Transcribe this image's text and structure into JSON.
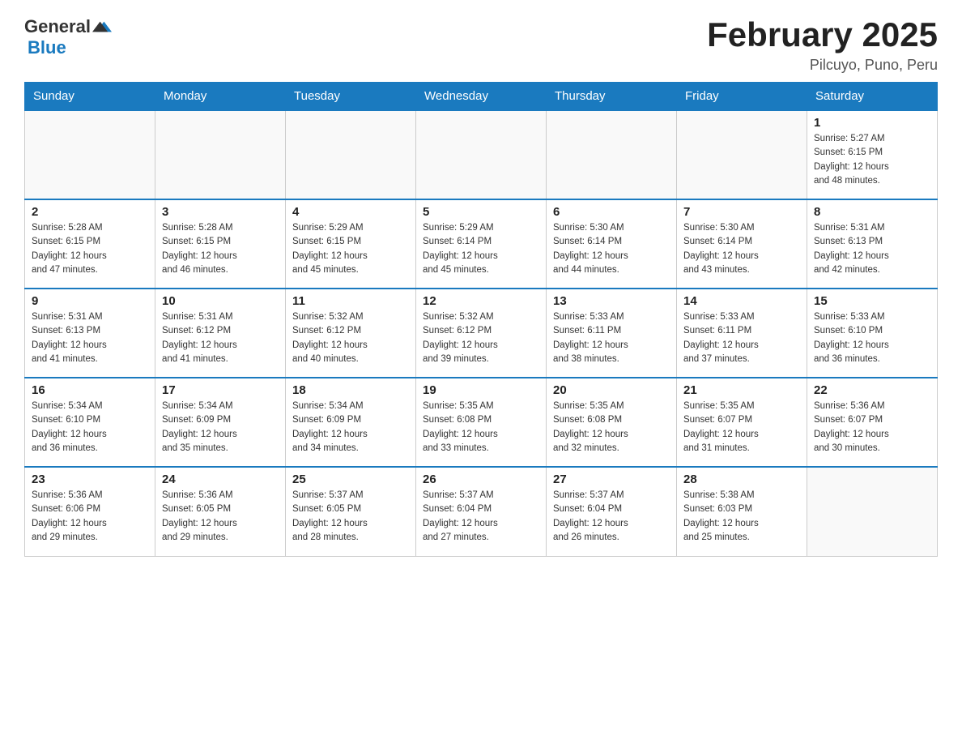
{
  "header": {
    "logo_general": "General",
    "logo_blue": "Blue",
    "title": "February 2025",
    "location": "Pilcuyo, Puno, Peru"
  },
  "weekdays": [
    "Sunday",
    "Monday",
    "Tuesday",
    "Wednesday",
    "Thursday",
    "Friday",
    "Saturday"
  ],
  "weeks": [
    [
      {
        "day": "",
        "info": ""
      },
      {
        "day": "",
        "info": ""
      },
      {
        "day": "",
        "info": ""
      },
      {
        "day": "",
        "info": ""
      },
      {
        "day": "",
        "info": ""
      },
      {
        "day": "",
        "info": ""
      },
      {
        "day": "1",
        "info": "Sunrise: 5:27 AM\nSunset: 6:15 PM\nDaylight: 12 hours\nand 48 minutes."
      }
    ],
    [
      {
        "day": "2",
        "info": "Sunrise: 5:28 AM\nSunset: 6:15 PM\nDaylight: 12 hours\nand 47 minutes."
      },
      {
        "day": "3",
        "info": "Sunrise: 5:28 AM\nSunset: 6:15 PM\nDaylight: 12 hours\nand 46 minutes."
      },
      {
        "day": "4",
        "info": "Sunrise: 5:29 AM\nSunset: 6:15 PM\nDaylight: 12 hours\nand 45 minutes."
      },
      {
        "day": "5",
        "info": "Sunrise: 5:29 AM\nSunset: 6:14 PM\nDaylight: 12 hours\nand 45 minutes."
      },
      {
        "day": "6",
        "info": "Sunrise: 5:30 AM\nSunset: 6:14 PM\nDaylight: 12 hours\nand 44 minutes."
      },
      {
        "day": "7",
        "info": "Sunrise: 5:30 AM\nSunset: 6:14 PM\nDaylight: 12 hours\nand 43 minutes."
      },
      {
        "day": "8",
        "info": "Sunrise: 5:31 AM\nSunset: 6:13 PM\nDaylight: 12 hours\nand 42 minutes."
      }
    ],
    [
      {
        "day": "9",
        "info": "Sunrise: 5:31 AM\nSunset: 6:13 PM\nDaylight: 12 hours\nand 41 minutes."
      },
      {
        "day": "10",
        "info": "Sunrise: 5:31 AM\nSunset: 6:12 PM\nDaylight: 12 hours\nand 41 minutes."
      },
      {
        "day": "11",
        "info": "Sunrise: 5:32 AM\nSunset: 6:12 PM\nDaylight: 12 hours\nand 40 minutes."
      },
      {
        "day": "12",
        "info": "Sunrise: 5:32 AM\nSunset: 6:12 PM\nDaylight: 12 hours\nand 39 minutes."
      },
      {
        "day": "13",
        "info": "Sunrise: 5:33 AM\nSunset: 6:11 PM\nDaylight: 12 hours\nand 38 minutes."
      },
      {
        "day": "14",
        "info": "Sunrise: 5:33 AM\nSunset: 6:11 PM\nDaylight: 12 hours\nand 37 minutes."
      },
      {
        "day": "15",
        "info": "Sunrise: 5:33 AM\nSunset: 6:10 PM\nDaylight: 12 hours\nand 36 minutes."
      }
    ],
    [
      {
        "day": "16",
        "info": "Sunrise: 5:34 AM\nSunset: 6:10 PM\nDaylight: 12 hours\nand 36 minutes."
      },
      {
        "day": "17",
        "info": "Sunrise: 5:34 AM\nSunset: 6:09 PM\nDaylight: 12 hours\nand 35 minutes."
      },
      {
        "day": "18",
        "info": "Sunrise: 5:34 AM\nSunset: 6:09 PM\nDaylight: 12 hours\nand 34 minutes."
      },
      {
        "day": "19",
        "info": "Sunrise: 5:35 AM\nSunset: 6:08 PM\nDaylight: 12 hours\nand 33 minutes."
      },
      {
        "day": "20",
        "info": "Sunrise: 5:35 AM\nSunset: 6:08 PM\nDaylight: 12 hours\nand 32 minutes."
      },
      {
        "day": "21",
        "info": "Sunrise: 5:35 AM\nSunset: 6:07 PM\nDaylight: 12 hours\nand 31 minutes."
      },
      {
        "day": "22",
        "info": "Sunrise: 5:36 AM\nSunset: 6:07 PM\nDaylight: 12 hours\nand 30 minutes."
      }
    ],
    [
      {
        "day": "23",
        "info": "Sunrise: 5:36 AM\nSunset: 6:06 PM\nDaylight: 12 hours\nand 29 minutes."
      },
      {
        "day": "24",
        "info": "Sunrise: 5:36 AM\nSunset: 6:05 PM\nDaylight: 12 hours\nand 29 minutes."
      },
      {
        "day": "25",
        "info": "Sunrise: 5:37 AM\nSunset: 6:05 PM\nDaylight: 12 hours\nand 28 minutes."
      },
      {
        "day": "26",
        "info": "Sunrise: 5:37 AM\nSunset: 6:04 PM\nDaylight: 12 hours\nand 27 minutes."
      },
      {
        "day": "27",
        "info": "Sunrise: 5:37 AM\nSunset: 6:04 PM\nDaylight: 12 hours\nand 26 minutes."
      },
      {
        "day": "28",
        "info": "Sunrise: 5:38 AM\nSunset: 6:03 PM\nDaylight: 12 hours\nand 25 minutes."
      },
      {
        "day": "",
        "info": ""
      }
    ]
  ]
}
